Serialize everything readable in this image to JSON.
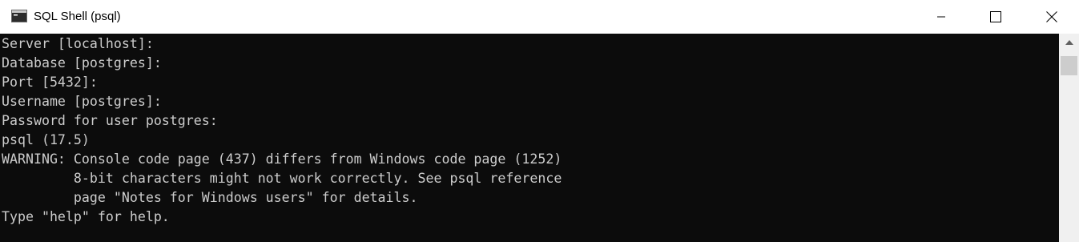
{
  "window": {
    "title": "SQL Shell (psql)",
    "icon": "console-app-icon"
  },
  "titlebar_buttons": {
    "minimize": "minimize-icon",
    "maximize": "maximize-icon",
    "close": "close-icon"
  },
  "console": {
    "lines": [
      "Server [localhost]:",
      "Database [postgres]:",
      "Port [5432]:",
      "Username [postgres]:",
      "Password for user postgres:",
      "psql (17.5)",
      "WARNING: Console code page (437) differs from Windows code page (1252)",
      "         8-bit characters might not work correctly. See psql reference",
      "         page \"Notes for Windows users\" for details.",
      "Type \"help\" for help."
    ],
    "text_color": "#cccccc",
    "background_color": "#0c0c0c"
  },
  "scrollbar": {
    "up_arrow": "chevron-up-icon"
  }
}
